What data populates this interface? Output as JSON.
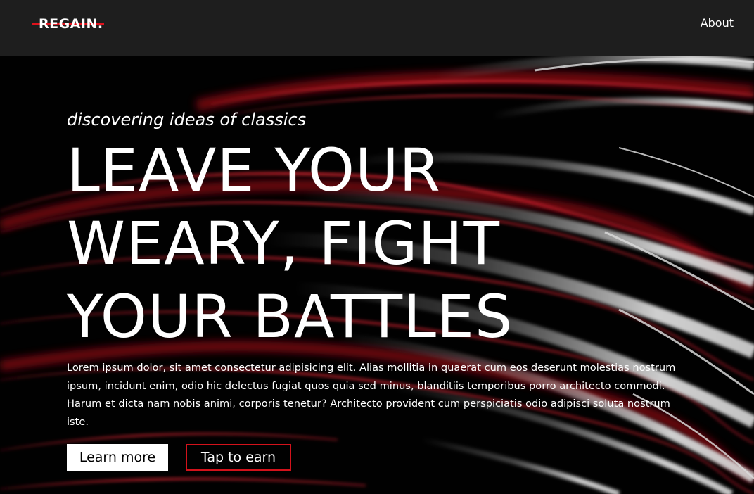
{
  "navbar": {
    "logo": "REGAIN.",
    "about_label": "About"
  },
  "hero": {
    "tagline": "discovering ideas of classics",
    "headline_lines": [
      "LEAVE YOUR",
      "WEARY, FIGHT",
      "YOUR BATTLES"
    ],
    "body": "Lorem ipsum dolor, sit amet consectetur adipisicing elit. Alias mollitia in quaerat cum eos deserunt molestias nostrum ipsum, incidunt enim, odio hic delectus fugiat quos quia sed minus, blanditiis temporibus porro architecto commodi. Harum et dicta nam nobis animi, corporis tenetur? Architecto provident cum perspiciatis odio adipisci soluta nostrum iste.",
    "learn_more_label": "Learn more",
    "tap_to_earn_label": "Tap to earn"
  },
  "colors": {
    "navbar_bg": "#1e1e1e",
    "accent_red": "#d3121b",
    "hero_bg": "#000000",
    "text": "#ffffff"
  }
}
